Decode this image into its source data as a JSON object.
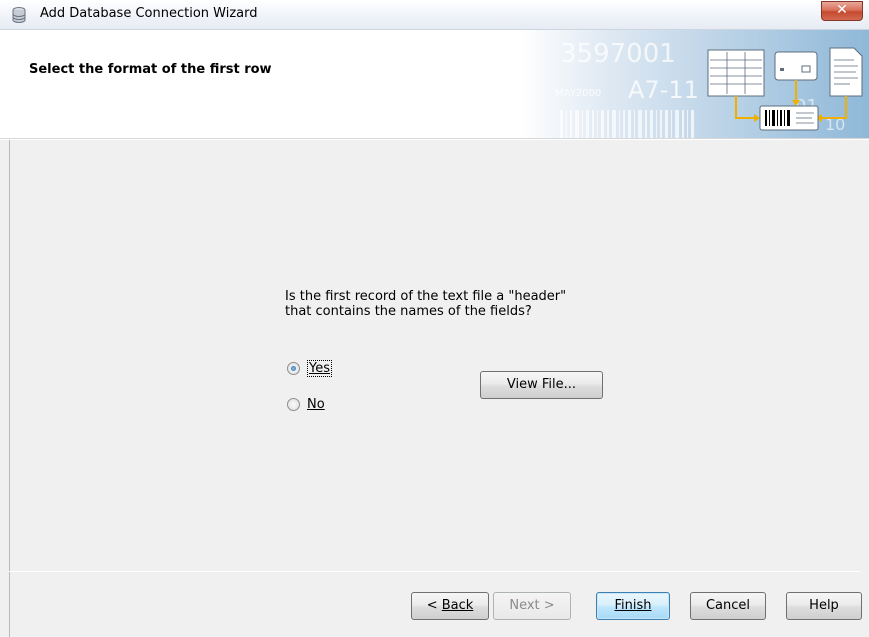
{
  "window": {
    "title": "Add Database Connection Wizard",
    "close_label": "✕",
    "icon": "database-icon"
  },
  "header": {
    "title": "Select the format of the first row",
    "art_text_1": "3597001",
    "art_text_2": "A7-11",
    "art_text_3": "MAY2000",
    "art_text_4": "01",
    "art_text_5": "10"
  },
  "question": {
    "text": "Is the first record of the text file a \"header\" that contains the names of the fields?"
  },
  "options": {
    "yes_label": "Yes",
    "no_label": "No",
    "selected": "Yes"
  },
  "buttons": {
    "view_file": "View File...",
    "back_prefix": "< ",
    "back": "Back",
    "next": "Next >",
    "finish": "Finish",
    "cancel": "Cancel",
    "help": "Help"
  },
  "colors": {
    "close_button": "#c44a2f",
    "content_bg": "#f0f0f0",
    "default_button_border": "#3c7fb1"
  }
}
